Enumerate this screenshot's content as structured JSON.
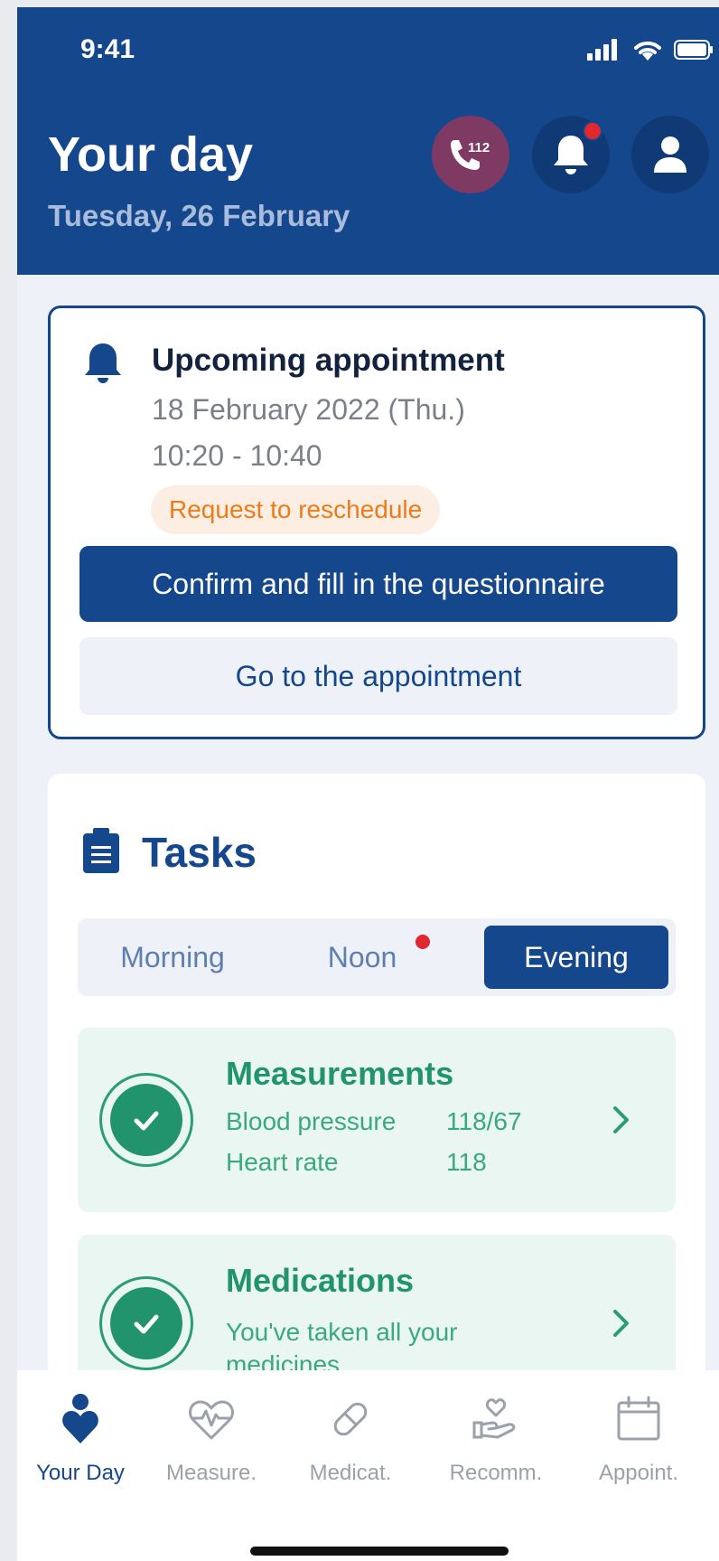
{
  "status_bar": {
    "time": "9:41"
  },
  "header": {
    "title": "Your day",
    "date": "Tuesday, 26 February",
    "emergency_number": "112"
  },
  "appointment": {
    "title": "Upcoming appointment",
    "date": "18 February 2022 (Thu.)",
    "time": "10:20 - 10:40",
    "badge": "Request to reschedule",
    "primary_button": "Confirm and fill in the questionnaire",
    "secondary_button": "Go to the appointment"
  },
  "tasks": {
    "title": "Tasks",
    "tabs": [
      {
        "label": "Morning",
        "active": false
      },
      {
        "label": "Noon",
        "active": false,
        "has_dot": true
      },
      {
        "label": "Evening",
        "active": true
      }
    ],
    "items": [
      {
        "title": "Measurements",
        "rows": [
          {
            "label": "Blood pressure",
            "value": "118/67"
          },
          {
            "label": "Heart rate",
            "value": "118"
          }
        ]
      },
      {
        "title": "Medications",
        "line1": "You've taken all your",
        "line2": "medicines"
      }
    ]
  },
  "nav": [
    {
      "label": "Your Day",
      "icon": "person-heart-icon",
      "active": true
    },
    {
      "label": "Measure.",
      "icon": "heart-pulse-icon",
      "active": false
    },
    {
      "label": "Medicat.",
      "icon": "pill-icon",
      "active": false
    },
    {
      "label": "Recomm.",
      "icon": "hand-heart-icon",
      "active": false
    },
    {
      "label": "Appoint.",
      "icon": "calendar-icon",
      "active": false
    }
  ],
  "colors": {
    "primary": "#15478c",
    "success": "#22946d",
    "warning": "#ec7b1a",
    "alert": "#e0282e",
    "emergency": "#7e3a62"
  }
}
